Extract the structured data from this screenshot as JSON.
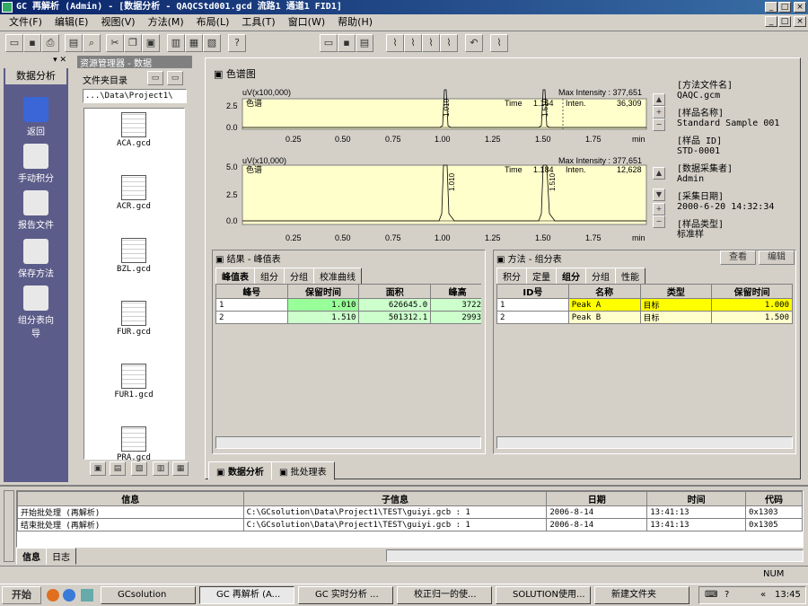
{
  "window": {
    "title": "GC 再解析 (Admin) - [数据分析 - QAQCStd001.gcd 流路1 通道1 FID1]"
  },
  "menu": [
    "文件(F)",
    "编辑(E)",
    "视图(V)",
    "方法(M)",
    "布局(L)",
    "工具(T)",
    "窗口(W)",
    "帮助(H)"
  ],
  "nav": {
    "title": "数据分析",
    "items": [
      {
        "label": "返回"
      },
      {
        "label": "手动积分"
      },
      {
        "label": "报告文件"
      },
      {
        "label": "保存方法"
      },
      {
        "label": "组分表向导"
      }
    ]
  },
  "files": {
    "header": "资源管理器 - 数据",
    "folder_label": "文件夹目录",
    "path": "...\\Data\\Project1\\",
    "items": [
      "ACA.gcd",
      "ACR.gcd",
      "BZL.gcd",
      "FUR.gcd",
      "FUR1.gcd",
      "PRA.gcd"
    ]
  },
  "chromatogram": {
    "title": "色谱图",
    "legend": "色谱",
    "top": {
      "ylabel": "uV(x100,000)",
      "max_intensity": "Max Intensity : 377,651",
      "time_label": "Time",
      "time_value": "1.164",
      "inten_label": "Inten.",
      "inten_value": "36,309",
      "yticks": [
        "2.5",
        "0.0"
      ],
      "peak1_label": "1.010",
      "peak2_label": "1.510"
    },
    "bottom": {
      "ylabel": "uV(x10,000)",
      "max_intensity": "Max Intensity : 377,651",
      "time_label": "Time",
      "time_value": "1.184",
      "inten_label": "Inten.",
      "inten_value": "12,628",
      "yticks": [
        "5.0",
        "2.5",
        "0.0"
      ],
      "peak1_label": "1.010",
      "peak2_label": "1.510"
    },
    "xticks": [
      "0.25",
      "0.50",
      "0.75",
      "1.00",
      "1.25",
      "1.50",
      "1.75"
    ],
    "xunit": "min"
  },
  "info": {
    "method_label": "[方法文件名]",
    "method_value": "QAQC.gcm",
    "sample_label": "[样品名称]",
    "sample_value": "Standard Sample 001",
    "id_label": "[样品 ID]",
    "id_value": "STD-0001",
    "operator_label": "[数据采集者]",
    "operator_value": "Admin",
    "date_label": "[采集日期]",
    "date_value": "2000-6-20 14:32:34",
    "type_label": "[样品类型]",
    "type_value": "标准样"
  },
  "results": {
    "title": "结果 - 峰值表",
    "tabs": [
      "峰值表",
      "组分",
      "分组",
      "校准曲线"
    ],
    "columns": [
      "峰号",
      "保留时间",
      "面积",
      "峰高"
    ],
    "rows": [
      [
        "1",
        "1.010",
        "626645.0",
        "3722"
      ],
      [
        "2",
        "1.510",
        "501312.1",
        "2993"
      ]
    ]
  },
  "method": {
    "title": "方法 - 组分表",
    "view_label": "查看",
    "edit_label": "编辑",
    "tabs": [
      "积分",
      "定量",
      "组分",
      "分组",
      "性能"
    ],
    "columns": [
      "ID号",
      "名称",
      "类型",
      "保留时间"
    ],
    "rows": [
      [
        "1",
        "Peak A",
        "目标",
        "1.000"
      ],
      [
        "2",
        "Peak B",
        "目标",
        "1.500"
      ]
    ]
  },
  "bottomtabs": [
    "数据分析",
    "批处理表"
  ],
  "log": {
    "columns": [
      "信息",
      "子信息",
      "日期",
      "时间",
      "代码"
    ],
    "rows": [
      [
        "开始批处理 (再解析)",
        "C:\\GCsolution\\Data\\Project1\\TEST\\guiyi.gcb : 1",
        "2006-8-14",
        "13:41:13",
        "0x1303"
      ],
      [
        "结束批处理 (再解析)",
        "C:\\GCsolution\\Data\\Project1\\TEST\\guiyi.gcb : 1",
        "2006-8-14",
        "13:41:13",
        "0x1305"
      ]
    ],
    "tabs": [
      "信息",
      "日志"
    ]
  },
  "status": {
    "num": "NUM"
  },
  "taskbar": {
    "start": "开始",
    "buttons": [
      "GCsolution",
      "GC 再解析 (A...",
      "GC 实时分析 ...",
      "校正归一的使...",
      "SOLUTION使用...",
      "新建文件夹"
    ],
    "clock": "13:45"
  }
}
